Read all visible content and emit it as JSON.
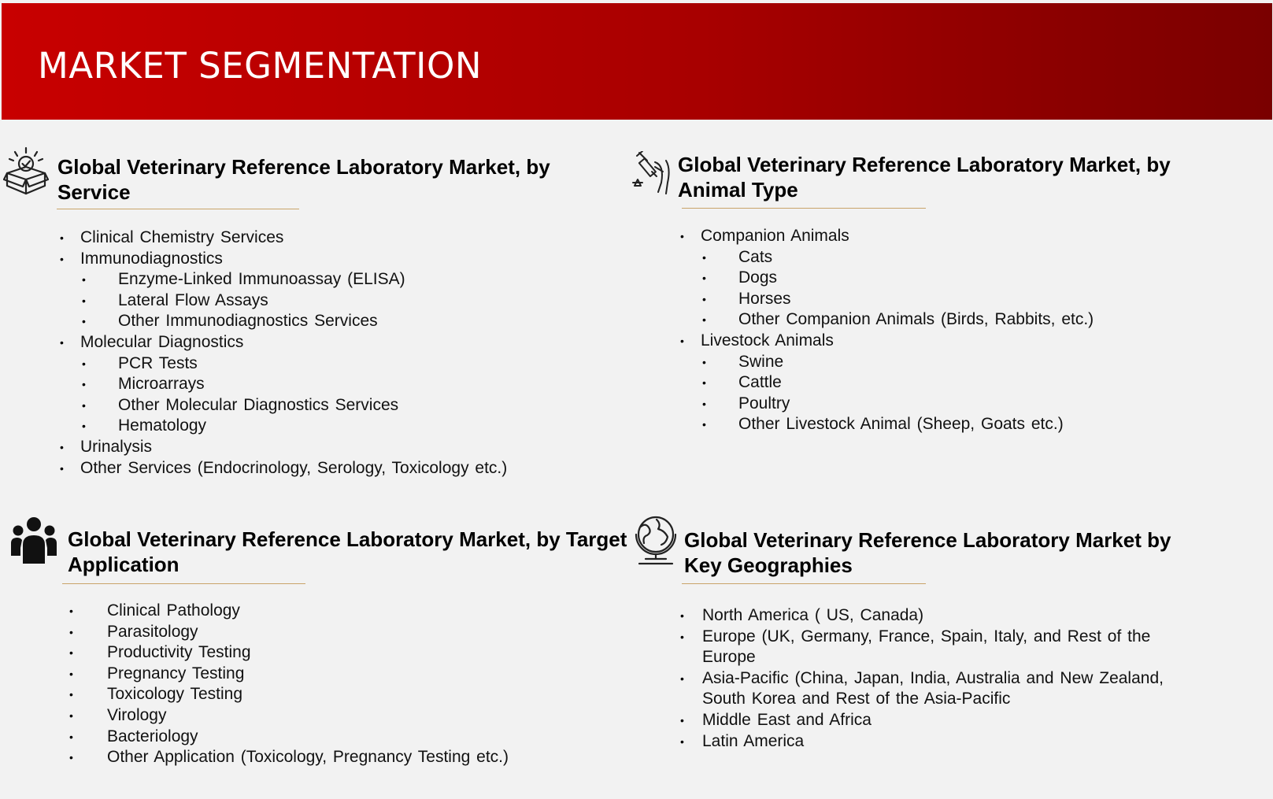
{
  "header": {
    "title": "MARKET SEGMENTATION"
  },
  "sections": [
    {
      "icon": "box-check-icon",
      "title": "Global Veterinary Reference Laboratory Market, by Service",
      "items": [
        {
          "level": 1,
          "text": "Clinical Chemistry Services"
        },
        {
          "level": 1,
          "text": "Immunodiagnostics"
        },
        {
          "level": 2,
          "text": "Enzyme-Linked Immunoassay (ELISA)"
        },
        {
          "level": 2,
          "text": "Lateral Flow Assays"
        },
        {
          "level": 2,
          "text": "Other Immunodiagnostics Services"
        },
        {
          "level": 1,
          "text": "Molecular Diagnostics"
        },
        {
          "level": 2,
          "text": "PCR Tests"
        },
        {
          "level": 2,
          "text": "Microarrays"
        },
        {
          "level": 2,
          "text": "Other Molecular Diagnostics Services"
        },
        {
          "level": 2,
          "text": "Hematology"
        },
        {
          "level": 1,
          "text": "Urinalysis"
        },
        {
          "level": 1,
          "text": "Other Services (Endocrinology, Serology, Toxicology etc.)"
        }
      ]
    },
    {
      "icon": "syringe-icon",
      "title": "Global Veterinary Reference Laboratory Market, by Animal Type",
      "items": [
        {
          "level": 1,
          "text": "Companion Animals"
        },
        {
          "level": 2,
          "text": "Cats"
        },
        {
          "level": 2,
          "text": "Dogs"
        },
        {
          "level": 2,
          "text": "Horses"
        },
        {
          "level": 2,
          "text": "Other Companion Animals (Birds, Rabbits, etc.)"
        },
        {
          "level": 1,
          "text": "Livestock Animals"
        },
        {
          "level": 2,
          "text": "Swine"
        },
        {
          "level": 2,
          "text": "Cattle"
        },
        {
          "level": 2,
          "text": "Poultry"
        },
        {
          "level": 2,
          "text": "Other Livestock Animal (Sheep, Goats etc.)"
        }
      ]
    },
    {
      "icon": "people-group-icon",
      "title": "Global Veterinary Reference Laboratory Market, by Target Application",
      "items": [
        {
          "level": 1,
          "text": "Clinical Pathology"
        },
        {
          "level": 1,
          "text": "Parasitology"
        },
        {
          "level": 1,
          "text": "Productivity Testing"
        },
        {
          "level": 1,
          "text": "Pregnancy Testing"
        },
        {
          "level": 1,
          "text": "Toxicology Testing"
        },
        {
          "level": 1,
          "text": "Virology"
        },
        {
          "level": 1,
          "text": "Bacteriology"
        },
        {
          "level": 1,
          "text": "Other Application (Toxicology, Pregnancy Testing etc.)"
        }
      ]
    },
    {
      "icon": "globe-icon",
      "title": "Global Veterinary Reference Laboratory Market by Key Geographies",
      "items": [
        {
          "level": 1,
          "text": "North America ( US, Canada)"
        },
        {
          "level": 1,
          "text": "Europe (UK, Germany, France, Spain, Italy, and Rest of the Europe"
        },
        {
          "level": 1,
          "text": "Asia-Pacific (China, Japan, India, Australia and New Zealand, South Korea and Rest of the Asia-Pacific"
        },
        {
          "level": 1,
          "text": "Middle East and Africa"
        },
        {
          "level": 1,
          "text": "Latin America"
        }
      ]
    }
  ]
}
